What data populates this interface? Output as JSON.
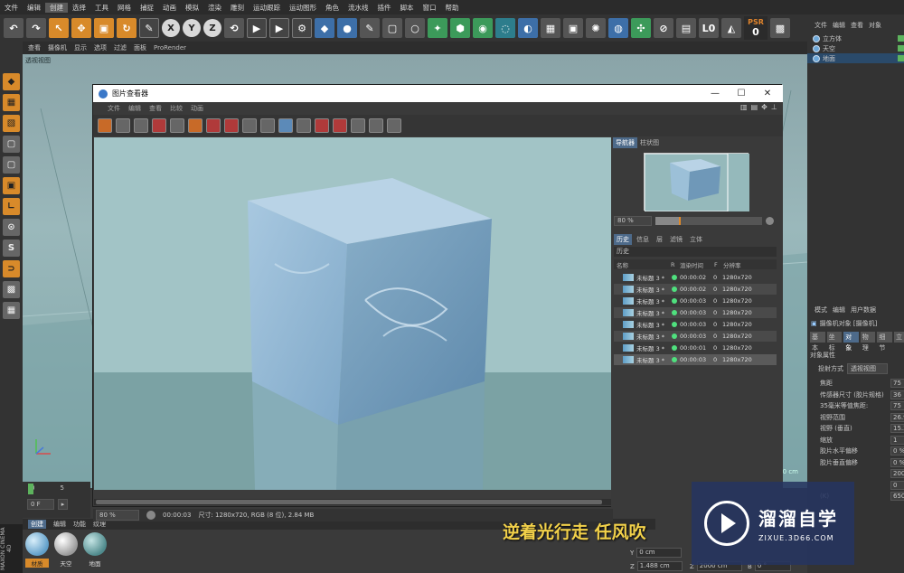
{
  "menubar": {
    "items": [
      "文件",
      "编辑",
      "创建",
      "选择",
      "工具",
      "网格",
      "捕捉",
      "动画",
      "模拟",
      "渲染",
      "雕刻",
      "运动跟踪",
      "运动图形",
      "角色",
      "流水线",
      "插件",
      "脚本",
      "窗口",
      "帮助"
    ],
    "active_index": 2
  },
  "toolbar": {
    "axis_x": "X",
    "axis_y": "Y",
    "axis_z": "Z",
    "psr_top": "PSR",
    "psr_value": "0",
    "l_label": "L0"
  },
  "viewport": {
    "menu": [
      "查看",
      "摄像机",
      "显示",
      "选项",
      "过滤",
      "面板",
      "ProRender"
    ],
    "label": "透视视图",
    "cm_label": "0 cm"
  },
  "object_manager": {
    "tabs": [
      "文件",
      "编辑",
      "查看",
      "对象"
    ],
    "objects": [
      {
        "name": "立方体"
      },
      {
        "name": "天空"
      },
      {
        "name": "地面"
      }
    ]
  },
  "attributes": {
    "tabs": [
      "模式",
      "编辑",
      "用户数据"
    ],
    "title": "摄像机对象 [摄像机]",
    "subtabs": [
      "基本",
      "坐标",
      "对象",
      "物理",
      "细节",
      "立"
    ],
    "active_subtab": 2,
    "section": "对象属性",
    "projection_label": "投射方式",
    "projection_value": "透视视图",
    "rows": [
      {
        "label": "焦距",
        "value": "75"
      },
      {
        "label": "传感器尺寸 (胶片规格)",
        "value": "36"
      },
      {
        "label": "35毫米等值焦距:",
        "value": "75 m"
      },
      {
        "label": "视野范围",
        "value": "26.9"
      },
      {
        "label": "视野 (垂直)",
        "value": "15.3"
      },
      {
        "label": "缩放",
        "value": "1"
      },
      {
        "label": "胶片水平偏移",
        "value": "0 %"
      },
      {
        "label": "胶片垂直偏移",
        "value": "0 %"
      },
      {
        "label": "",
        "value": "2000"
      },
      {
        "label": "",
        "value": "0"
      },
      {
        "label": "(K)",
        "value": "6500"
      }
    ]
  },
  "picture_viewer": {
    "title": "图片查看器",
    "controls": {
      "min": "—",
      "max": "☐",
      "close": "✕"
    },
    "menu": [
      "文件",
      "编辑",
      "查看",
      "比较",
      "动画"
    ],
    "status": {
      "zoom": "80 %",
      "time": "00:00:03",
      "info": "尺寸: 1280x720, RGB (8 位), 2.84 MB"
    },
    "navigator": {
      "tabs": [
        "导航器",
        "柱状图"
      ],
      "zoom": "80 %"
    },
    "history": {
      "tabs": [
        "历史",
        "信息",
        "层",
        "滤镜",
        "立体"
      ],
      "title": "历史",
      "columns": [
        "名称",
        "R",
        "渲染时间",
        "F",
        "分辨率"
      ],
      "rows": [
        {
          "name": "未标题 3 *",
          "time": "00:00:02",
          "f": "0",
          "res": "1280x720"
        },
        {
          "name": "未标题 3 *",
          "time": "00:00:02",
          "f": "0",
          "res": "1280x720"
        },
        {
          "name": "未标题 3 *",
          "time": "00:00:03",
          "f": "0",
          "res": "1280x720"
        },
        {
          "name": "未标题 3 *",
          "time": "00:00:03",
          "f": "0",
          "res": "1280x720"
        },
        {
          "name": "未标题 3 *",
          "time": "00:00:03",
          "f": "0",
          "res": "1280x720"
        },
        {
          "name": "未标题 3 *",
          "time": "00:00:03",
          "f": "0",
          "res": "1280x720"
        },
        {
          "name": "未标题 3 *",
          "time": "00:00:01",
          "f": "0",
          "res": "1280x720"
        },
        {
          "name": "未标题 3 *",
          "time": "00:00:03",
          "f": "0",
          "res": "1280x720"
        }
      ]
    }
  },
  "timeline": {
    "ticks": [
      "0",
      "5"
    ],
    "frame": "0 F"
  },
  "materials": {
    "menu": [
      "创建",
      "编辑",
      "功能",
      "纹理"
    ],
    "items": [
      "材质",
      "天空",
      "地面"
    ],
    "selected_index": 0
  },
  "branding": {
    "vertical": "MAXON CINEMA 4D"
  },
  "coordinates": {
    "y_label": "Y",
    "y_value": "0 cm",
    "z_label": "Z",
    "z_value": "1.488 cm",
    "s_label": "Z",
    "s_value": "2000 cm",
    "b_label": "B",
    "b_value": "0 °"
  },
  "subtitle": "逆着光行走 任风吹",
  "watermark": {
    "title": "溜溜自学",
    "url": "ZIXUE.3D66.COM"
  },
  "colors": {
    "accent": "#d88a2a",
    "selection": "#4d6a8a",
    "render_dot": "#4fe07e"
  }
}
